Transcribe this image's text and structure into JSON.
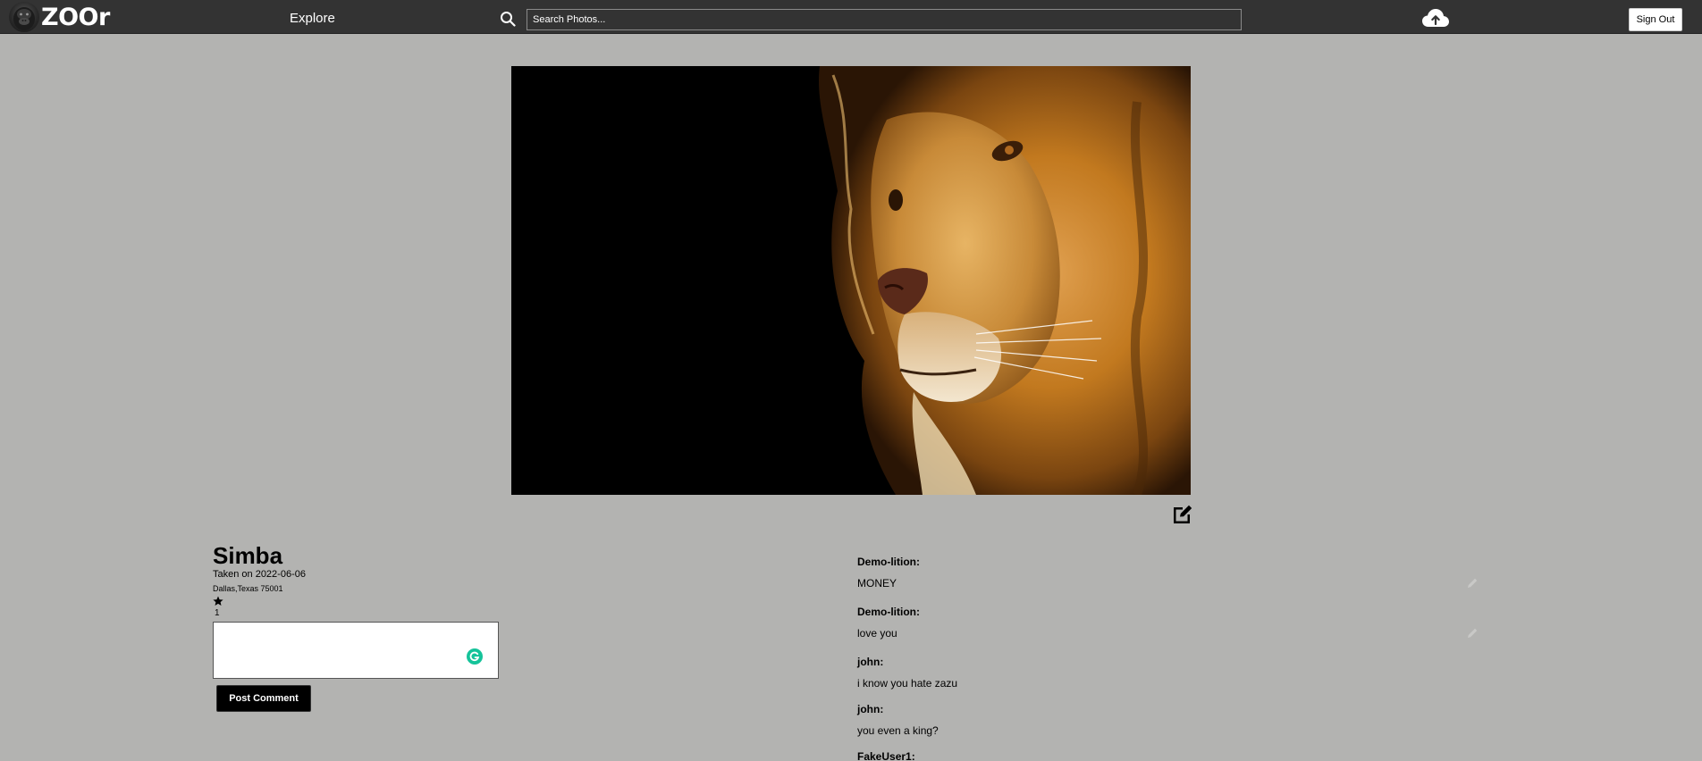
{
  "nav": {
    "brand": "ZOOr",
    "explore_label": "Explore",
    "search_placeholder": "Search Photos...",
    "search_value": "",
    "signout_label": "Sign Out",
    "icons": {
      "logo": "gorilla-logo-icon",
      "search": "search-icon",
      "upload": "cloud-upload-icon"
    }
  },
  "photo": {
    "image_icon": "lion-photo",
    "edit_icon": "edit-icon"
  },
  "info": {
    "title": "Simba",
    "taken_on": "Taken on 2022-06-06",
    "location": "Dallas,Texas 75001",
    "fav_icon": "star-icon",
    "fav_count": "1",
    "comment_value": "",
    "post_label": "Post Comment"
  },
  "comments": [
    {
      "author": "Demo-lition:",
      "text": "MONEY",
      "editable": true
    },
    {
      "author": "Demo-lition:",
      "text": "love you",
      "editable": true
    },
    {
      "author": "john:",
      "text": "i know you hate zazu",
      "editable": false
    },
    {
      "author": "john:",
      "text": "you even a king?",
      "editable": false
    },
    {
      "author": "FakeUser1:",
      "text": "",
      "editable": false
    }
  ]
}
